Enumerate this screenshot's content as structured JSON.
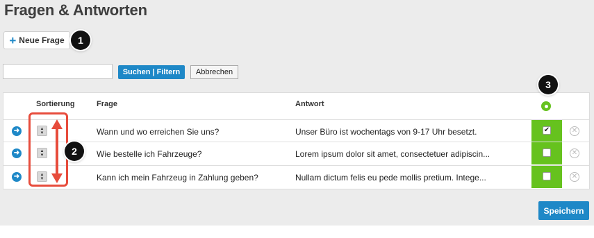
{
  "header": {
    "title": "Fragen & Antworten"
  },
  "toolbar": {
    "new_label": "Neue Frage",
    "new_icon": "plus-icon"
  },
  "search": {
    "value": "",
    "search_label": "Suchen | Filtern",
    "cancel_label": "Abbrechen"
  },
  "table": {
    "columns": {
      "sort": "Sortierung",
      "question": "Frage",
      "answer": "Antwort"
    },
    "rows": [
      {
        "question": "Wann und wo erreichen Sie uns?",
        "answer": "Unser Büro ist wochentags von 9-17 Uhr besetzt.",
        "active": true
      },
      {
        "question": "Wie bestelle ich Fahrzeuge?",
        "answer": "Lorem ipsum dolor sit amet, consectetuer adipiscin...",
        "active": false
      },
      {
        "question": "Kann ich mein Fahrzeug in Zahlung geben?",
        "answer": "Nullam dictum felis eu pede mollis pretium. Intege...",
        "active": false
      }
    ]
  },
  "callouts": [
    "1",
    "2",
    "3"
  ],
  "footer": {
    "save_label": "Speichern"
  },
  "colors": {
    "accent_blue": "#1e88c7",
    "active_green": "#66c21e",
    "annotation_red": "#e74c3c"
  }
}
